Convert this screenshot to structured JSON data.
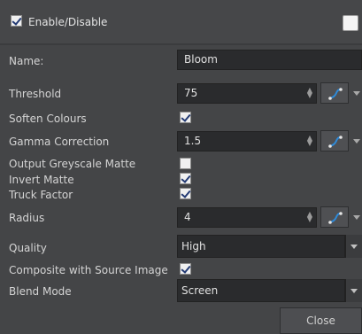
{
  "header": {
    "enable_label": "Enable/Disable",
    "enable_checked": true
  },
  "fields": {
    "name_label": "Name:",
    "name_value": "Bloom",
    "threshold_label": "Threshold",
    "threshold_value": "75",
    "soften_label": "Soften Colours",
    "gamma_label": "Gamma Correction",
    "gamma_value": "1.5",
    "greyscale_label": "Output Greyscale Matte",
    "invert_label": "Invert Matte",
    "truck_label": "Truck Factor",
    "radius_label": "Radius",
    "radius_value": "4",
    "quality_label": "Quality",
    "quality_value": "High",
    "composite_label": "Composite with Source Image",
    "blend_label": "Blend Mode",
    "blend_value": "Screen"
  },
  "checkboxes": {
    "soften": true,
    "greyscale": false,
    "invert": true,
    "truck": true,
    "composite": true
  },
  "icons": {
    "spin": "spin-arrows-icon",
    "function_curve": "function-curve-icon",
    "dropdown": "dropdown-arrow-icon"
  },
  "footer": {
    "close_label": "Close"
  },
  "colors": {
    "background": "#444547",
    "field": "#2a2b2d",
    "checkmark": "#233a73",
    "curve_accent": "#2f8ad8"
  }
}
